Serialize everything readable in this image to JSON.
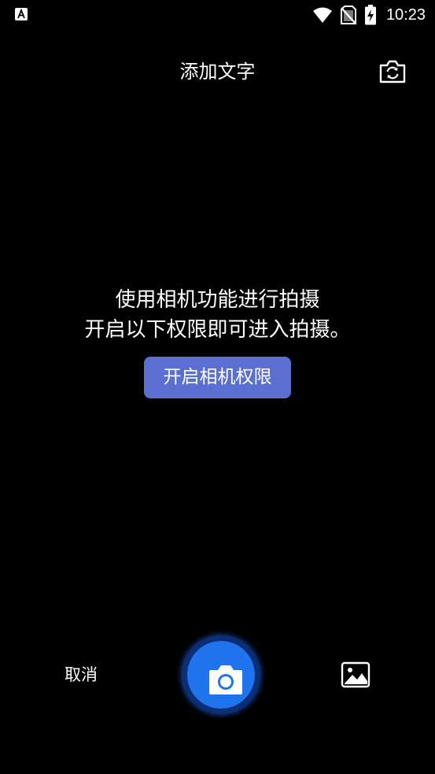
{
  "status_bar": {
    "time": "10:23",
    "icons": [
      "app-notification-icon",
      "wifi-icon",
      "no-sim-icon",
      "battery-charging-icon"
    ]
  },
  "header": {
    "title": "添加文字",
    "switch_camera_icon": "camera-switch-icon"
  },
  "message": {
    "line1": "使用相机功能进行拍摄",
    "line2": "开启以下权限即可进入拍摄。"
  },
  "permission_button": {
    "label": "开启相机权限",
    "color": "#5b6fd0"
  },
  "bottom_bar": {
    "cancel_label": "取消",
    "shutter_icon": "camera-icon",
    "shutter_color": "#1f73ec",
    "gallery_icon": "image-gallery-icon"
  }
}
